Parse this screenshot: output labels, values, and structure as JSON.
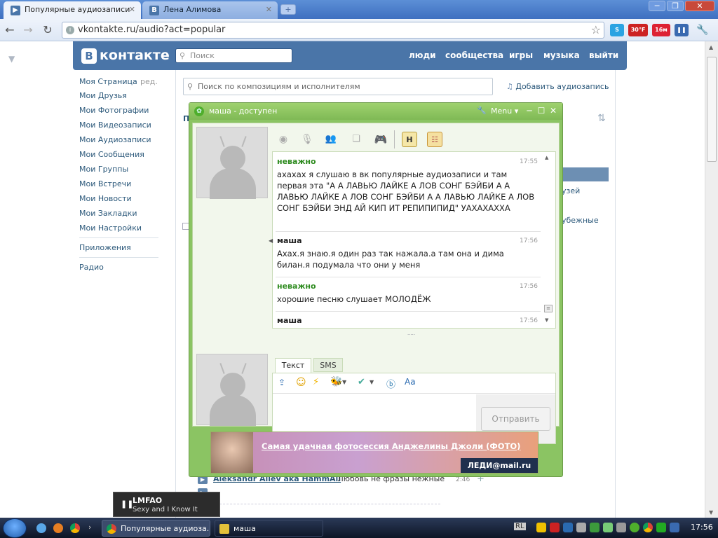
{
  "browser": {
    "tabs": [
      {
        "title": "Популярные аудиозаписи",
        "active": true
      },
      {
        "title": "Лена Алимова",
        "active": false
      }
    ],
    "url": "vkontakte.ru/audio?act=popular",
    "extensions": {
      "weather": "30°F",
      "counter": "16м"
    }
  },
  "vk": {
    "logo": "контакте",
    "logo_letter": "В",
    "search_placeholder": "Поиск",
    "top_nav": [
      "люди",
      "сообщества",
      "игры",
      "музыка",
      "выйти"
    ],
    "left_nav": [
      "Моя Страница",
      "Мои Друзья",
      "Мои Фотографии",
      "Мои Видеозаписи",
      "Мои Аудиозаписи",
      "Мои Сообщения",
      "Мои Группы",
      "Мои Встречи",
      "Мои Новости",
      "Мои Закладки",
      "Мои Настройки",
      "Приложения",
      "Радио"
    ],
    "edit_label": "ред.",
    "audio_search_placeholder": "Поиск по композициям и исполнителям",
    "add_audio": "Добавить аудиозапись",
    "partial_right": [
      "узей",
      "убежные"
    ],
    "track_artist": "Aleksandr Aliev aka HammAli",
    "track_title": " - Любовь не фразы нежные",
    "track_time": "2:46",
    "sort_icon": "⇅"
  },
  "chat": {
    "title": "маша - доступен",
    "menu": "Menu",
    "messages": [
      {
        "name": "неважно",
        "time": "17:55",
        "text": "ахахах я слушаю в вк популярные аудиозаписи и там первая эта \"А А ЛАВЬЮ ЛАЙКЕ А ЛОВ СОНГ БЭЙБИ А А ЛАВЬЮ ЛАЙКЕ А ЛОВ СОНГ БЭЙБИ А А ЛАВЬЮ ЛАЙКЕ А ЛОВ СОНГ БЭЙБИ ЭНД АЙ КИП ИТ РЕПИПИПИД\" УАХАХАХХА",
        "color": "#2e8b1f"
      },
      {
        "name": "маша",
        "time": "17:56",
        "text": "Ахах.я знаю.я один раз так нажала.а там она и дима билан.я подумала что они у меня",
        "color": "#222222"
      },
      {
        "name": "неважно",
        "time": "17:56",
        "text": "хорошие песню слушает МОЛОДЁЖ",
        "color": "#2e8b1f"
      },
      {
        "name": "маша",
        "time": "17:56",
        "text": "",
        "color": "#222222"
      }
    ],
    "tab_text": "Текст",
    "tab_sms": "SMS",
    "send": "Отправить",
    "toolbar_h": "H",
    "ad_text": "Самая удачная фотосессия Анджелины Джоли (ФОТО)",
    "ad_brand": "ЛЕДИ@mail.ru"
  },
  "notification": {
    "title": "LMFAO",
    "subtitle": "Sexy and I Know It"
  },
  "taskbar": {
    "items": [
      "Популярные аудиоза...",
      "маша"
    ],
    "lang": "RL",
    "clock": "17:56"
  }
}
